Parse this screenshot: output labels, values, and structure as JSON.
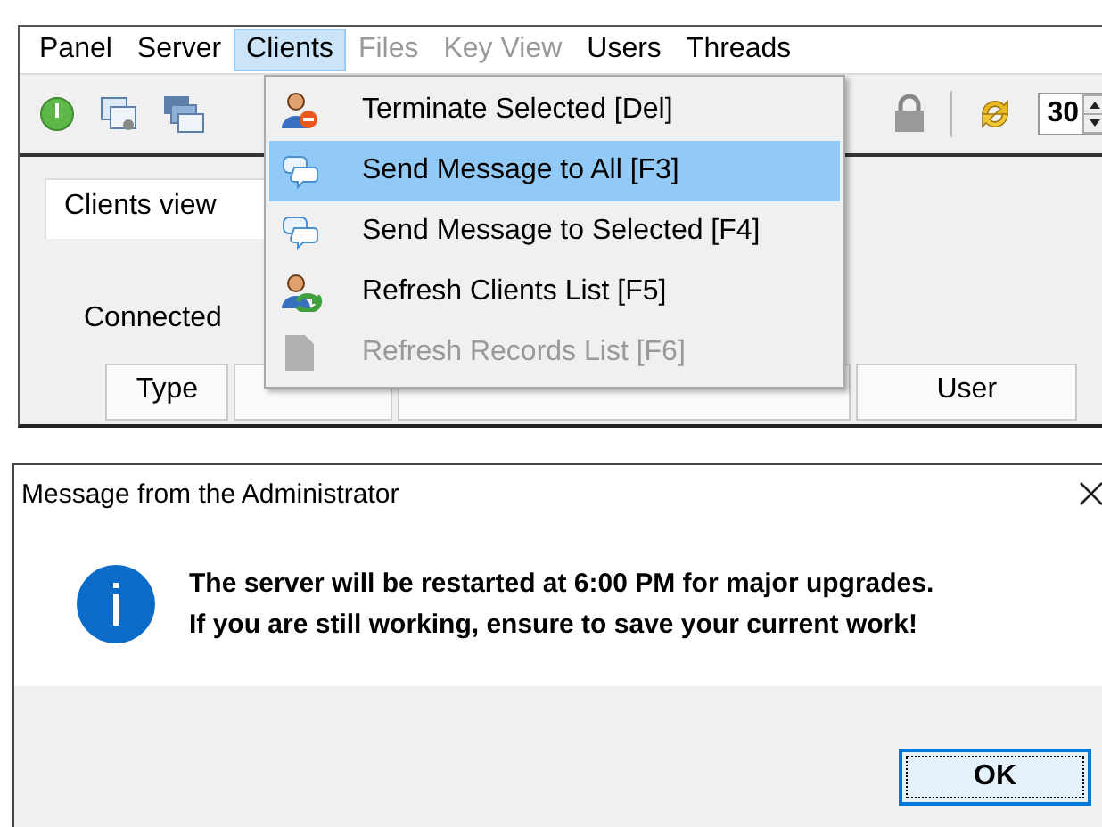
{
  "menu_bar": [
    {
      "label": "Panel",
      "selected": false,
      "disabled": false
    },
    {
      "label": "Server",
      "selected": false,
      "disabled": false
    },
    {
      "label": "Clients",
      "selected": true,
      "disabled": false
    },
    {
      "label": "Files",
      "selected": false,
      "disabled": true
    },
    {
      "label": "Key View",
      "selected": false,
      "disabled": true
    },
    {
      "label": "Users",
      "selected": false,
      "disabled": false
    },
    {
      "label": "Threads",
      "selected": false,
      "disabled": false
    }
  ],
  "toolbar": {
    "refresh_interval": "30"
  },
  "clients_menu": [
    {
      "label": "Terminate Selected [Del]",
      "kind": "terminate",
      "selected": false,
      "disabled": false
    },
    {
      "label": "Send Message to All [F3]",
      "kind": "message",
      "selected": true,
      "disabled": false
    },
    {
      "label": "Send Message to Selected [F4]",
      "kind": "message",
      "selected": false,
      "disabled": false
    },
    {
      "label": "Refresh Clients List [F5]",
      "kind": "refresh",
      "selected": false,
      "disabled": false
    },
    {
      "label": "Refresh Records List [F6]",
      "kind": "records",
      "selected": false,
      "disabled": true
    }
  ],
  "tabs": [
    {
      "label": "Clients view",
      "selected": true
    }
  ],
  "connected_label": "Connected",
  "table": {
    "columns": [
      "Type",
      "User"
    ]
  },
  "dialog": {
    "title": "Message from the Administrator",
    "message_lines": [
      "The server will be restarted at 6:00 PM for major upgrades.",
      "If you are still working, ensure to save your current work!"
    ],
    "button": "OK"
  }
}
